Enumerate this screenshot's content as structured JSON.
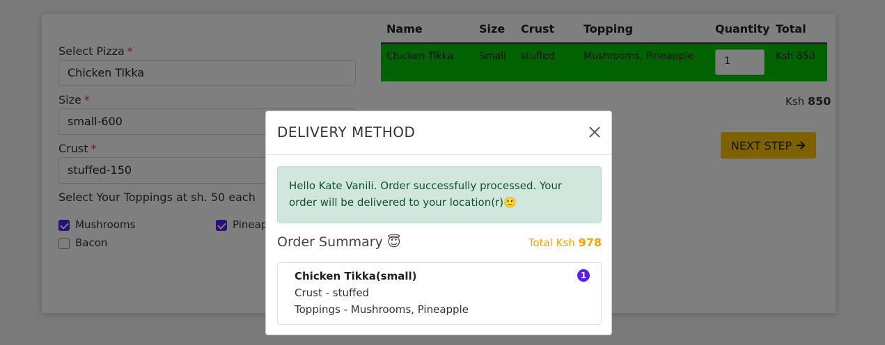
{
  "form": {
    "pizza_label": "Select Pizza",
    "pizza_value": "Chicken Tikka",
    "size_label": "Size",
    "size_value": "small-600",
    "crust_label": "Crust",
    "crust_value": "stuffed-150",
    "required_mark": "*",
    "toppings_label": "Select Your Toppings at sh. 50 each",
    "toppings": [
      {
        "label": "Mushrooms",
        "checked": true
      },
      {
        "label": "Pineapple",
        "checked": true
      },
      {
        "label": "Bacon",
        "checked": false
      }
    ]
  },
  "cart": {
    "headers": [
      "Name",
      "Size",
      "Crust",
      "Topping",
      "Quantity",
      "Total"
    ],
    "rows": [
      {
        "name": "Chicken Tikka",
        "size": "Small",
        "crust": "stuffed",
        "topping": "Mushrooms, Pineapple",
        "quantity": "1",
        "total": "Ksh 850"
      }
    ],
    "row_color": "#00c400",
    "grand_prefix": "Ksh",
    "grand_value": "850",
    "next_label": "NEXT STEP",
    "next_icon": "arrow-right-icon",
    "next_color": "#ffc400"
  },
  "modal": {
    "title": "DELIVERY METHOD",
    "close_icon": "close-icon",
    "alert_text": "Hello Kate Vanili. Order successfully processed. Your order will be delivered to your location(r)🙂",
    "summary_title": "Order Summary 😇",
    "total_prefix": "Total Ksh",
    "total_value": "978",
    "item_title": "Chicken Tikka(small)",
    "item_crust": "Crust - stuffed",
    "item_toppings": "Toppings - Mushrooms, Pineapple",
    "item_count": "1",
    "accent_color": "#5a1cf0",
    "total_color": "#ff9f00"
  }
}
